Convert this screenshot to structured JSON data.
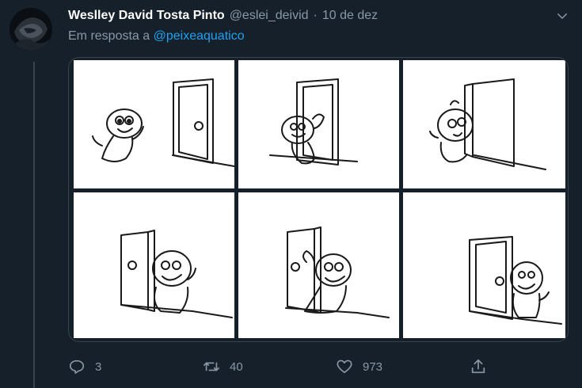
{
  "tweet": {
    "author_name": "Weslley David Tosta Pinto",
    "author_handle": "@eslei_deivid",
    "separator": "·",
    "date": "10 de dez",
    "reply_prefix": "Em resposta a",
    "reply_to": "@peixeaquatico"
  },
  "media": {
    "panel_count": 6
  },
  "actions": {
    "reply_count": "3",
    "retweet_count": "40",
    "like_count": "973"
  },
  "icons": {
    "reply": "speech-bubble-icon",
    "retweet": "retweet-arrows-icon",
    "like": "heart-icon",
    "share": "share-upload-icon",
    "menu": "chevron-down-icon"
  },
  "colors": {
    "background": "#15202b",
    "secondary_text": "#8899a6",
    "link": "#1da1f2",
    "border": "#38444d"
  }
}
